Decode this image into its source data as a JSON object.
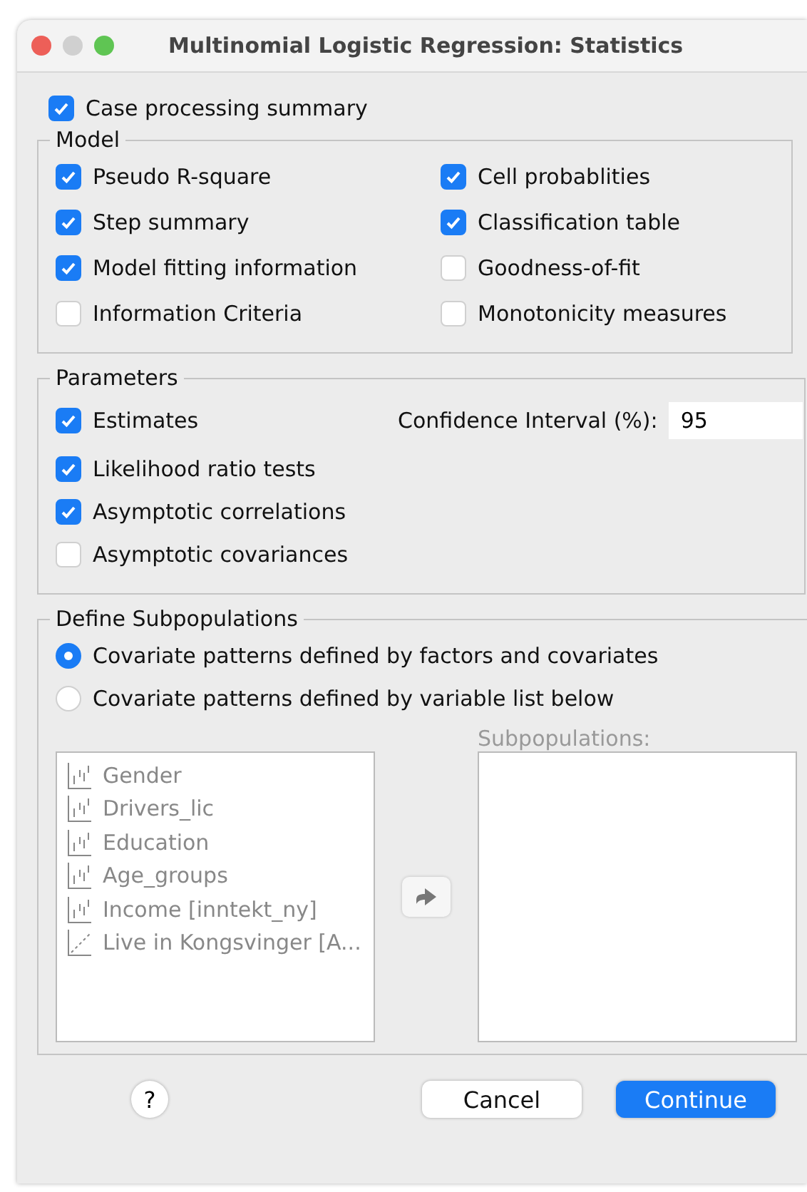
{
  "window": {
    "title": "Multinomial Logistic Regression: Statistics"
  },
  "case_processing": {
    "label": "Case processing summary",
    "checked": true
  },
  "model": {
    "title": "Model",
    "items": [
      {
        "label": "Pseudo R-square",
        "checked": true
      },
      {
        "label": "Cell probablities",
        "checked": true
      },
      {
        "label": "Step summary",
        "checked": true
      },
      {
        "label": "Classification table",
        "checked": true
      },
      {
        "label": "Model fitting information",
        "checked": true
      },
      {
        "label": "Goodness-of-fit",
        "checked": false
      },
      {
        "label": "Information Criteria",
        "checked": false
      },
      {
        "label": "Monotonicity measures",
        "checked": false
      }
    ]
  },
  "parameters": {
    "title": "Parameters",
    "items": [
      {
        "label": "Estimates",
        "checked": true
      },
      {
        "label": "Likelihood ratio tests",
        "checked": true
      },
      {
        "label": "Asymptotic correlations",
        "checked": true
      },
      {
        "label": "Asymptotic covariances",
        "checked": false
      }
    ],
    "confidence_label": "Confidence Interval (%):",
    "confidence_value": "95"
  },
  "subpopulations": {
    "title": "Define Subpopulations",
    "options": [
      {
        "label": "Covariate patterns defined by factors and covariates",
        "selected": true
      },
      {
        "label": "Covariate patterns defined by variable list below",
        "selected": false
      }
    ],
    "variables_disabled": true,
    "variables": [
      {
        "label": "Gender",
        "kind": "nominal"
      },
      {
        "label": "Drivers_lic",
        "kind": "nominal"
      },
      {
        "label": "Education",
        "kind": "nominal"
      },
      {
        "label": "Age_groups",
        "kind": "nominal"
      },
      {
        "label": "Income [inntekt_ny]",
        "kind": "nominal"
      },
      {
        "label": "Live in Kongsvinger [A...",
        "kind": "scale"
      }
    ],
    "target_label": "Subpopulations:"
  },
  "buttons": {
    "help": "?",
    "cancel": "Cancel",
    "continue": "Continue"
  }
}
